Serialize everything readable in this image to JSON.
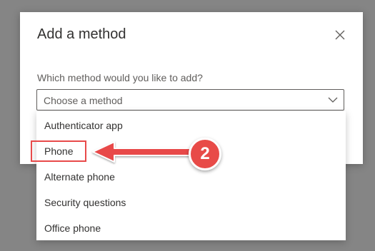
{
  "dialog": {
    "title": "Add a method",
    "subtitle": "Which method would you like to add?",
    "close_icon": "close-icon",
    "select": {
      "placeholder": "Choose a method",
      "chevron_icon": "chevron-down-icon"
    }
  },
  "dropdown": {
    "options": [
      {
        "label": "Authenticator app"
      },
      {
        "label": "Phone"
      },
      {
        "label": "Alternate phone"
      },
      {
        "label": "Security questions"
      },
      {
        "label": "Office phone"
      }
    ],
    "highlighted_option": "Phone"
  },
  "annotation": {
    "step_number": "2",
    "color": "#e84a4a"
  },
  "colors": {
    "overlay": "#858585",
    "dialog_bg": "#ffffff",
    "text_primary": "#323130",
    "text_secondary": "#605e5c",
    "annotation_red": "#e84a4a"
  }
}
